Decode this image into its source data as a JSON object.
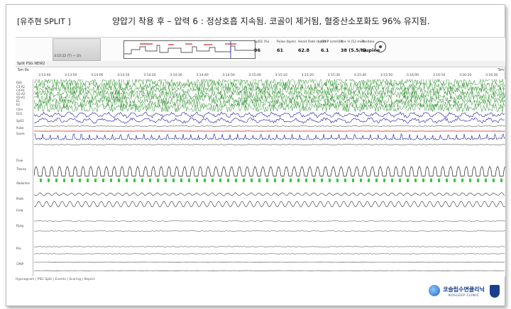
{
  "slide": {
    "patient_label": "[유주현 SPLIT ]",
    "caption": "양압기 착용 후 – 압력 6 : 정상호흡 지속됨. 코골이 제거됨, 혈중산소포화도 96% 유지됨."
  },
  "header": {
    "thumbnail_label": "3:15:12 (T) ~ (2)",
    "vitals": [
      {
        "label": "SpO2 (%)",
        "value": "96"
      },
      {
        "label": "Pulse (bpm)",
        "value": "61"
      },
      {
        "label": "Heart Rate (bpm)",
        "value": "62.8"
      },
      {
        "label": "CPAP (cmH2O)",
        "value": "6.1"
      },
      {
        "label": "A + H (12 min)",
        "value": "38 (5.5/h)"
      },
      {
        "label": "Position",
        "value": "Supine"
      }
    ]
  },
  "montage": {
    "name": "Split PSG NEW2"
  },
  "epoch": {
    "start": "5m 0s",
    "end": "5m"
  },
  "time_ticks": [
    "3:13:40",
    "3:13:50",
    "3:14:00",
    "3:14:10",
    "3:14:20",
    "3:14:30",
    "3:14:40",
    "3:14:50",
    "3:15:00",
    "3:15:10",
    "3:15:20",
    "3:15:30",
    "3:15:40",
    "3:15:50",
    "3:16:00",
    "3:16:10",
    "3:16:20",
    "3:16:30"
  ],
  "channels": [
    "EEG",
    "C3-A2",
    "C4-A1",
    "O1-A2",
    "O2-A1",
    "E1",
    "E2",
    "Chin",
    "ECG",
    "SpO2",
    "Pulse",
    "Snore",
    "Flow",
    "Thorax",
    "Abdomen",
    "Pleth",
    "LLeg",
    "RLeg",
    "Pos",
    "CPAP"
  ],
  "status_bar": "Hypnogram | PSG Split | Events | Scoring | Report",
  "logo": {
    "name": "코슬립수면클리닉",
    "subtitle": "KOSLEEP CLINIC"
  },
  "colors": {
    "eeg": "#1e8a1e",
    "eog": "#1a1aa8",
    "spo2": "#cc2020",
    "flow_marker": "#33cc33",
    "hypnogram_event": "#d02020"
  }
}
